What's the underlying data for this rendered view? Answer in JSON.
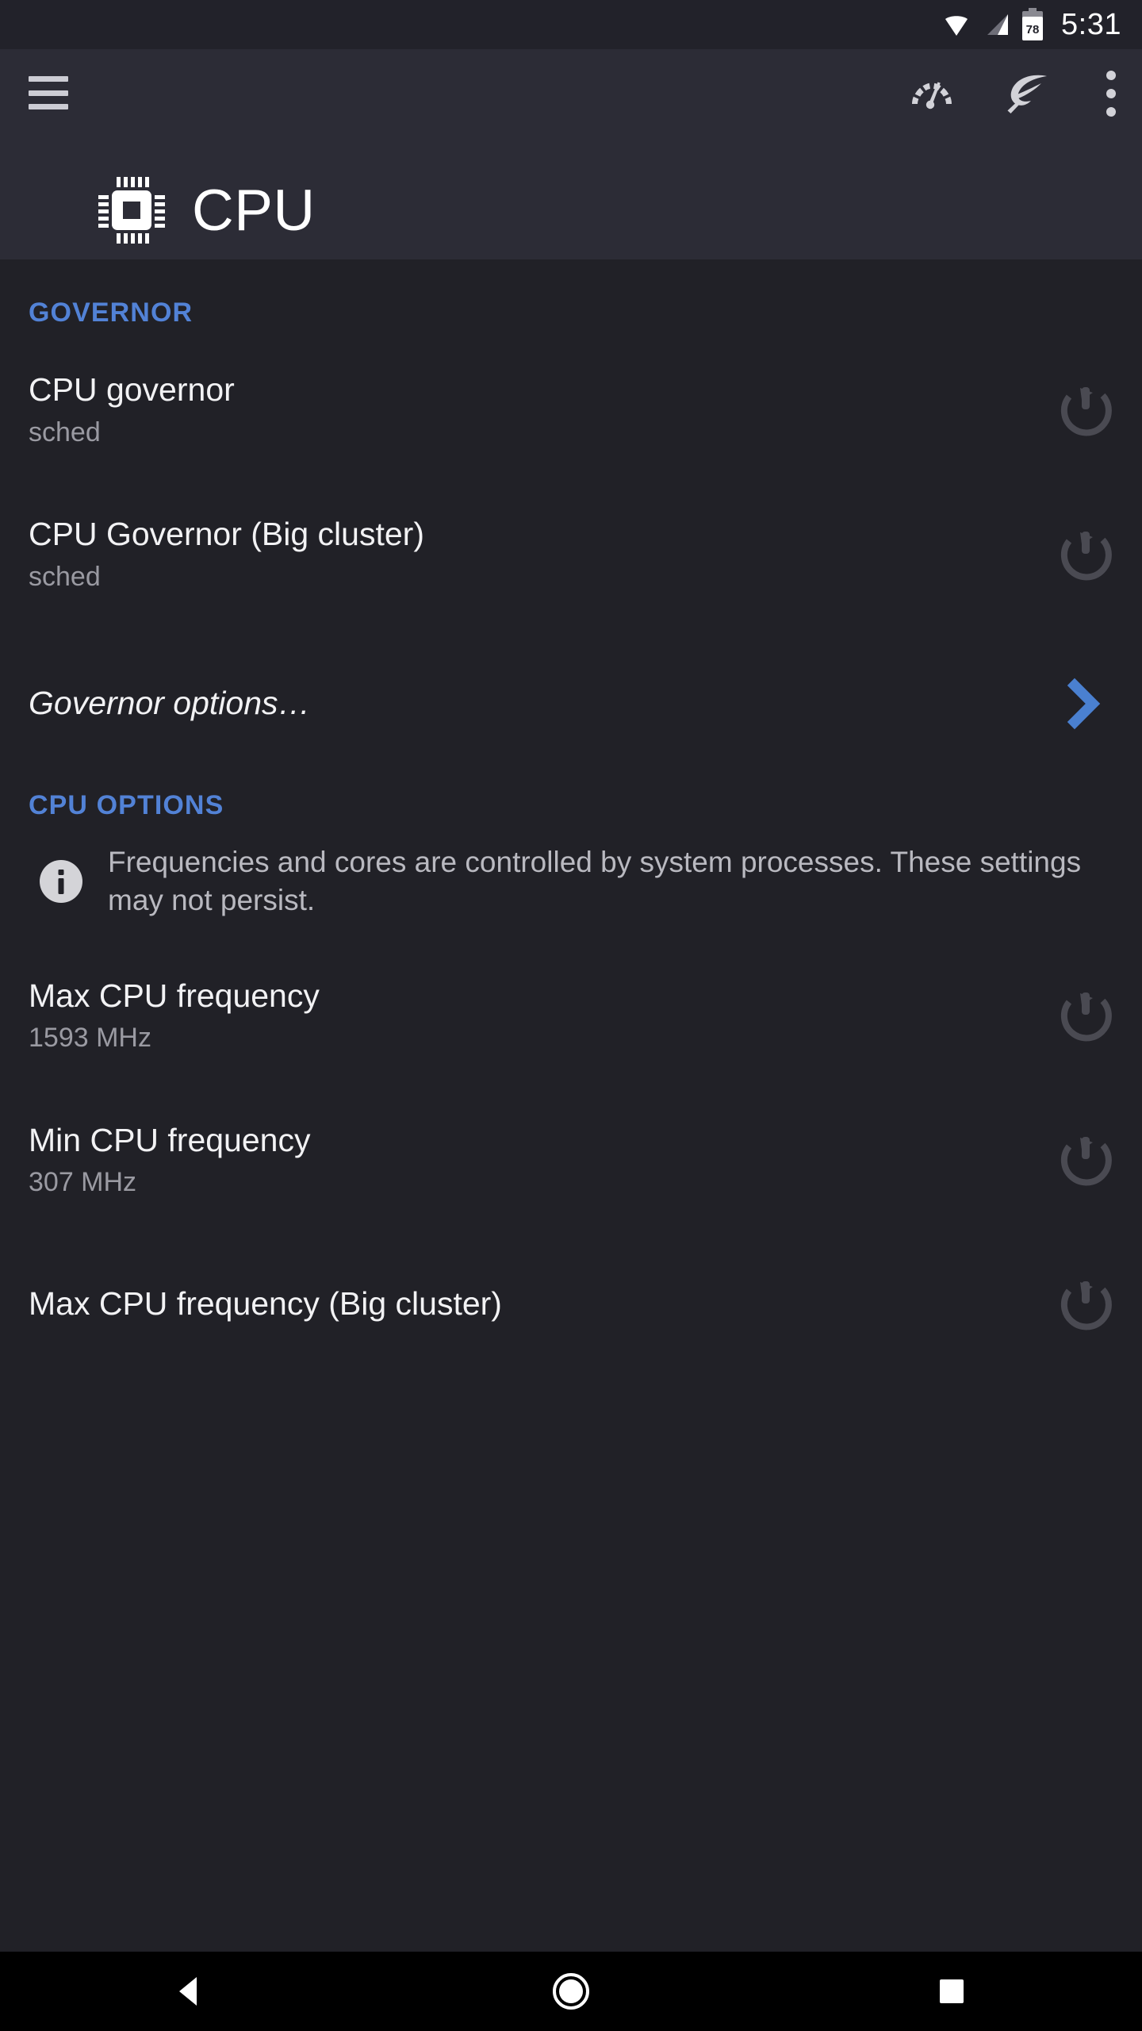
{
  "status_bar": {
    "time": "5:31",
    "battery_percent": "78",
    "icons": [
      "wifi-icon",
      "cellular-signal-icon",
      "battery-icon"
    ]
  },
  "app_bar": {
    "menu_icon": "hamburger-menu-icon",
    "actions": [
      {
        "name": "dashboard-icon",
        "label": "Dashboard"
      },
      {
        "name": "leaf-icon",
        "label": "Battery saver"
      },
      {
        "name": "overflow-menu-icon",
        "label": "More options"
      }
    ],
    "title": "CPU",
    "title_icon": "cpu-chip-icon"
  },
  "colors": {
    "accent_blue": "#5282d6",
    "chevron_blue": "#4a80d0",
    "appbar_bg": "#2c2c36",
    "body_bg": "#212127",
    "statusbar_bg": "#22222a",
    "navbar_bg": "#000000",
    "primary_text": "#f2f2f4",
    "secondary_text": "#9a9aa2",
    "action_icon": "#4a4a52"
  },
  "sections": [
    {
      "header": "GOVERNOR",
      "rows": [
        {
          "title": "CPU governor",
          "subtitle": "sched",
          "action": "power-restore-icon",
          "italic": false
        },
        {
          "title": "CPU Governor (Big cluster)",
          "subtitle": "sched",
          "action": "power-restore-icon",
          "italic": false
        },
        {
          "title": "Governor options…",
          "subtitle": "",
          "action": "chevron-right-icon",
          "italic": true
        }
      ]
    },
    {
      "header": "CPU OPTIONS",
      "info": {
        "icon": "info-icon",
        "text": "Frequencies and cores are controlled by system processes. These settings may not persist."
      },
      "rows": [
        {
          "title": "Max CPU frequency",
          "subtitle": "1593 MHz",
          "action": "power-restore-icon",
          "italic": false
        },
        {
          "title": "Min CPU frequency",
          "subtitle": "307 MHz",
          "action": "power-restore-icon",
          "italic": false
        },
        {
          "title": "Max CPU frequency (Big cluster)",
          "subtitle": "",
          "action": "power-restore-icon",
          "italic": false
        }
      ]
    }
  ],
  "nav_bar": {
    "buttons": [
      {
        "name": "back-button",
        "icon": "triangle-back-icon"
      },
      {
        "name": "home-button",
        "icon": "circle-home-icon"
      },
      {
        "name": "recents-button",
        "icon": "square-recents-icon"
      }
    ]
  }
}
